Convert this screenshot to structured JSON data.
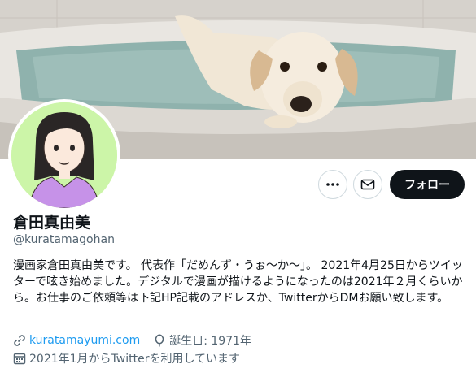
{
  "banner": {
    "description_icon": "dog-in-bathtub-photo"
  },
  "profile": {
    "display_name": "倉田真由美",
    "handle": "@kuratamagohan",
    "bio": "漫画家倉田真由美です。 代表作「だめんず・うぉ〜か〜」。 2021年4月25日からツイッターで呟き始めました。デジタルで漫画が描けるようになったのは2021年２月くらいから。お仕事のご依頼等は下記HP記載のアドレスか、TwitterからDMお願い致します。",
    "website": "kuratamayumi.com",
    "birthday": "誕生日: 1971年",
    "joined": "2021年1月からTwitterを利用しています"
  },
  "actions": {
    "more_icon": "more-dots-icon",
    "message_icon": "mail-icon",
    "follow_label": "フォロー"
  },
  "colors": {
    "accent": "#1d9bf0",
    "text_primary": "#0f1419",
    "text_secondary": "#536471",
    "follow_bg": "#0f1419",
    "avatar_bg": "#ccf5a8"
  }
}
